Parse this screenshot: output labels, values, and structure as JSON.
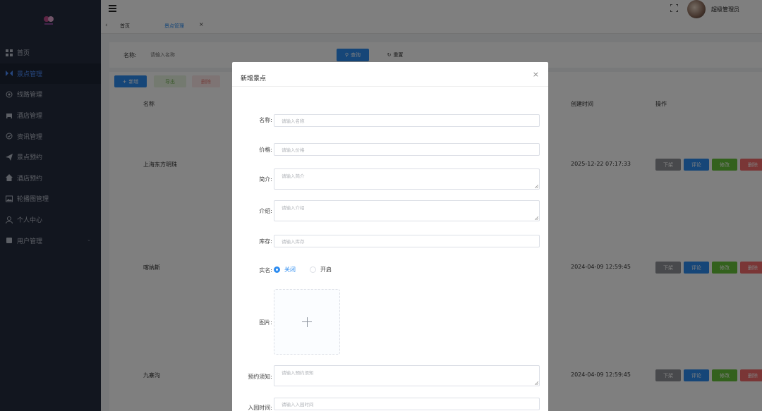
{
  "sidebar": {
    "items": [
      {
        "label": "首页",
        "icon": "dashboard-icon"
      },
      {
        "label": "景点管理",
        "icon": "scenic-icon",
        "active": true
      },
      {
        "label": "线路管理",
        "icon": "route-icon"
      },
      {
        "label": "酒店管理",
        "icon": "hotel-icon"
      },
      {
        "label": "资讯管理",
        "icon": "news-icon"
      },
      {
        "label": "景点预约",
        "icon": "send-icon"
      },
      {
        "label": "酒店预约",
        "icon": "home-icon"
      },
      {
        "label": "轮播图管理",
        "icon": "image-icon"
      },
      {
        "label": "个人中心",
        "icon": "user-icon"
      },
      {
        "label": "用户管理",
        "icon": "users-icon"
      }
    ]
  },
  "header": {
    "user_name": "超级管理员"
  },
  "tabs": {
    "home": "首页",
    "current": "景点管理",
    "close": "×",
    "back": "‹"
  },
  "search": {
    "label": "名称:",
    "placeholder": "请输入名称",
    "query_label": "查询",
    "reset_label": "重置"
  },
  "toolbar": {
    "add": "新增",
    "export": "导出",
    "delete": "删除"
  },
  "table": {
    "columns": {
      "name": "名称",
      "created": "创建时间",
      "ops": "操作"
    },
    "rows": [
      {
        "name": "上海东方明珠",
        "created": "2025-12-22 07:17:33"
      },
      {
        "name": "喀纳斯",
        "created": "2024-04-09 12:59:45"
      },
      {
        "name": "九寨沟",
        "created": "2024-04-09 12:59:45"
      }
    ],
    "ops": {
      "down": "下架",
      "comment": "评论",
      "edit": "修改",
      "delete": "删除"
    }
  },
  "dialog": {
    "title": "新增景点",
    "close": "×",
    "fields": {
      "name": {
        "label": "名称",
        "placeholder": "请输入名称"
      },
      "price": {
        "label": "价格",
        "placeholder": "请输入价格"
      },
      "intro": {
        "label": "简介",
        "placeholder": "请输入简介"
      },
      "desc": {
        "label": "介绍",
        "placeholder": "请输入介绍"
      },
      "stock": {
        "label": "库存",
        "placeholder": "请输入库存"
      },
      "realname": {
        "label": "实名",
        "option_off": "关闭",
        "option_on": "开启",
        "selected": "关闭"
      },
      "image": {
        "label": "图片"
      },
      "notice": {
        "label": "预约须知",
        "placeholder": "请输入预约须知"
      },
      "entry_time": {
        "label": "入园时间",
        "placeholder": "请输入入园时间"
      }
    }
  },
  "colors": {
    "primary": "#2d8cf0",
    "sidebar_bg": "#252d3f",
    "success": "#67c23a",
    "danger": "#f56c6c",
    "info": "#909399"
  }
}
